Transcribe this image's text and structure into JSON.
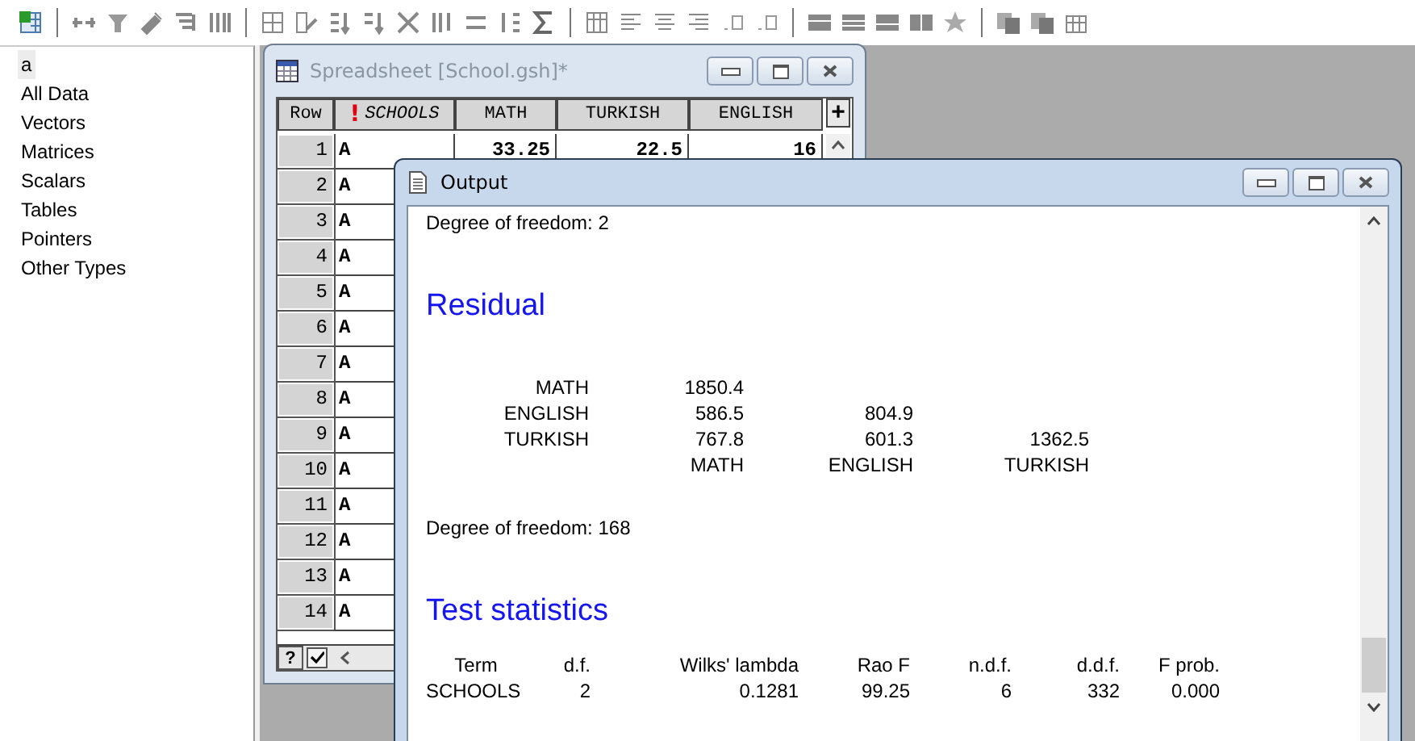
{
  "sidebar": {
    "items": [
      {
        "label": "a",
        "selected": true
      },
      {
        "label": "All Data",
        "selected": false
      },
      {
        "label": "Vectors",
        "selected": false
      },
      {
        "label": "Matrices",
        "selected": false
      },
      {
        "label": "Scalars",
        "selected": false
      },
      {
        "label": "Tables",
        "selected": false
      },
      {
        "label": "Pointers",
        "selected": false
      },
      {
        "label": "Other Types",
        "selected": false
      }
    ]
  },
  "spreadsheet": {
    "title": "Spreadsheet [School.gsh]*",
    "columns": [
      {
        "label": "Row"
      },
      {
        "label": "SCHOOLS",
        "flag": "!"
      },
      {
        "label": "MATH"
      },
      {
        "label": "TURKISH"
      },
      {
        "label": "ENGLISH"
      }
    ],
    "add_column": "+",
    "rows": [
      {
        "cells": [
          "1",
          "A",
          "33.25",
          "22.5",
          "16"
        ]
      },
      {
        "cells": [
          "2",
          "A"
        ]
      },
      {
        "cells": [
          "3",
          "A"
        ]
      },
      {
        "cells": [
          "4",
          "A"
        ]
      },
      {
        "cells": [
          "5",
          "A"
        ]
      },
      {
        "cells": [
          "6",
          "A"
        ]
      },
      {
        "cells": [
          "7",
          "A"
        ]
      },
      {
        "cells": [
          "8",
          "A"
        ]
      },
      {
        "cells": [
          "9",
          "A"
        ]
      },
      {
        "cells": [
          "10",
          "A"
        ]
      },
      {
        "cells": [
          "11",
          "A"
        ]
      },
      {
        "cells": [
          "12",
          "A"
        ]
      },
      {
        "cells": [
          "13",
          "A"
        ]
      },
      {
        "cells": [
          "14",
          "A"
        ]
      }
    ],
    "footer": {
      "help": "?",
      "checked": true
    }
  },
  "output": {
    "title": "Output",
    "blocks": [
      {
        "kind": "text",
        "text": "Degree of freedom: 2"
      },
      {
        "kind": "heading",
        "text": "Residual"
      },
      {
        "kind": "matrix",
        "rows": [
          {
            "label": "MATH",
            "values": [
              "1850.4"
            ]
          },
          {
            "label": "ENGLISH",
            "values": [
              "586.5",
              "804.9"
            ]
          },
          {
            "label": "TURKISH",
            "values": [
              "767.8",
              "601.3",
              "1362.5"
            ]
          }
        ],
        "footer": [
          "MATH",
          "ENGLISH",
          "TURKISH"
        ]
      },
      {
        "kind": "text",
        "text": "Degree of freedom: 168"
      },
      {
        "kind": "heading",
        "text": "Test statistics"
      },
      {
        "kind": "table",
        "columns": [
          "Term",
          "d.f.",
          "Wilks' lambda",
          "Rao F",
          "n.d.f.",
          "d.d.f.",
          "F prob."
        ],
        "rows": [
          [
            "SCHOOLS",
            "2",
            "0.1281",
            "99.25",
            "6",
            "332",
            "0.000"
          ]
        ]
      }
    ]
  }
}
